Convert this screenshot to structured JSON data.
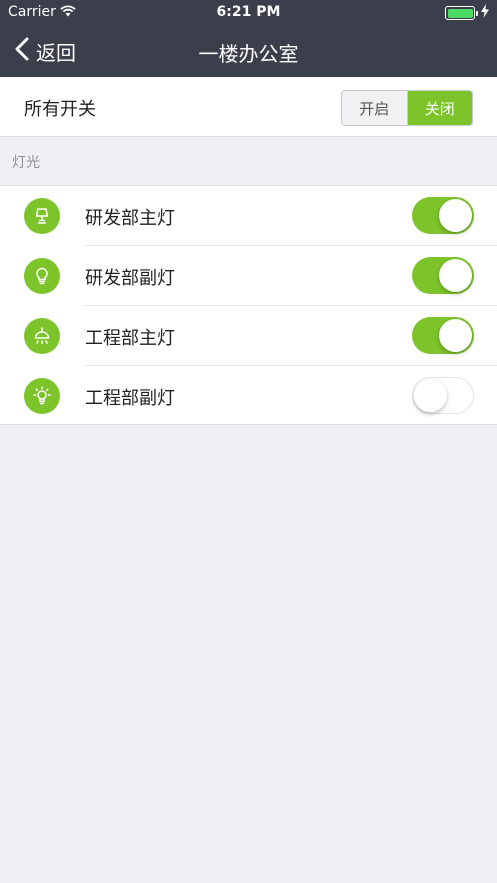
{
  "status_bar": {
    "carrier": "Carrier",
    "time": "6:21 PM"
  },
  "nav": {
    "back_label": "返回",
    "title": "一楼办公室"
  },
  "all_switch": {
    "label": "所有开关",
    "on_label": "开启",
    "off_label": "关闭",
    "selected": "关闭"
  },
  "section": {
    "title": "灯光"
  },
  "lights": [
    {
      "label": "研发部主灯",
      "icon": "desk-lamp-icon",
      "on": true
    },
    {
      "label": "研发部副灯",
      "icon": "light-bulb-icon",
      "on": true
    },
    {
      "label": "工程部主灯",
      "icon": "ceiling-lamp-icon",
      "on": true
    },
    {
      "label": "工程部副灯",
      "icon": "bright-bulb-icon",
      "on": false
    }
  ],
  "colors": {
    "accent": "#7cc42a",
    "navbar": "#3a3f4b",
    "background": "#eff0f4"
  }
}
